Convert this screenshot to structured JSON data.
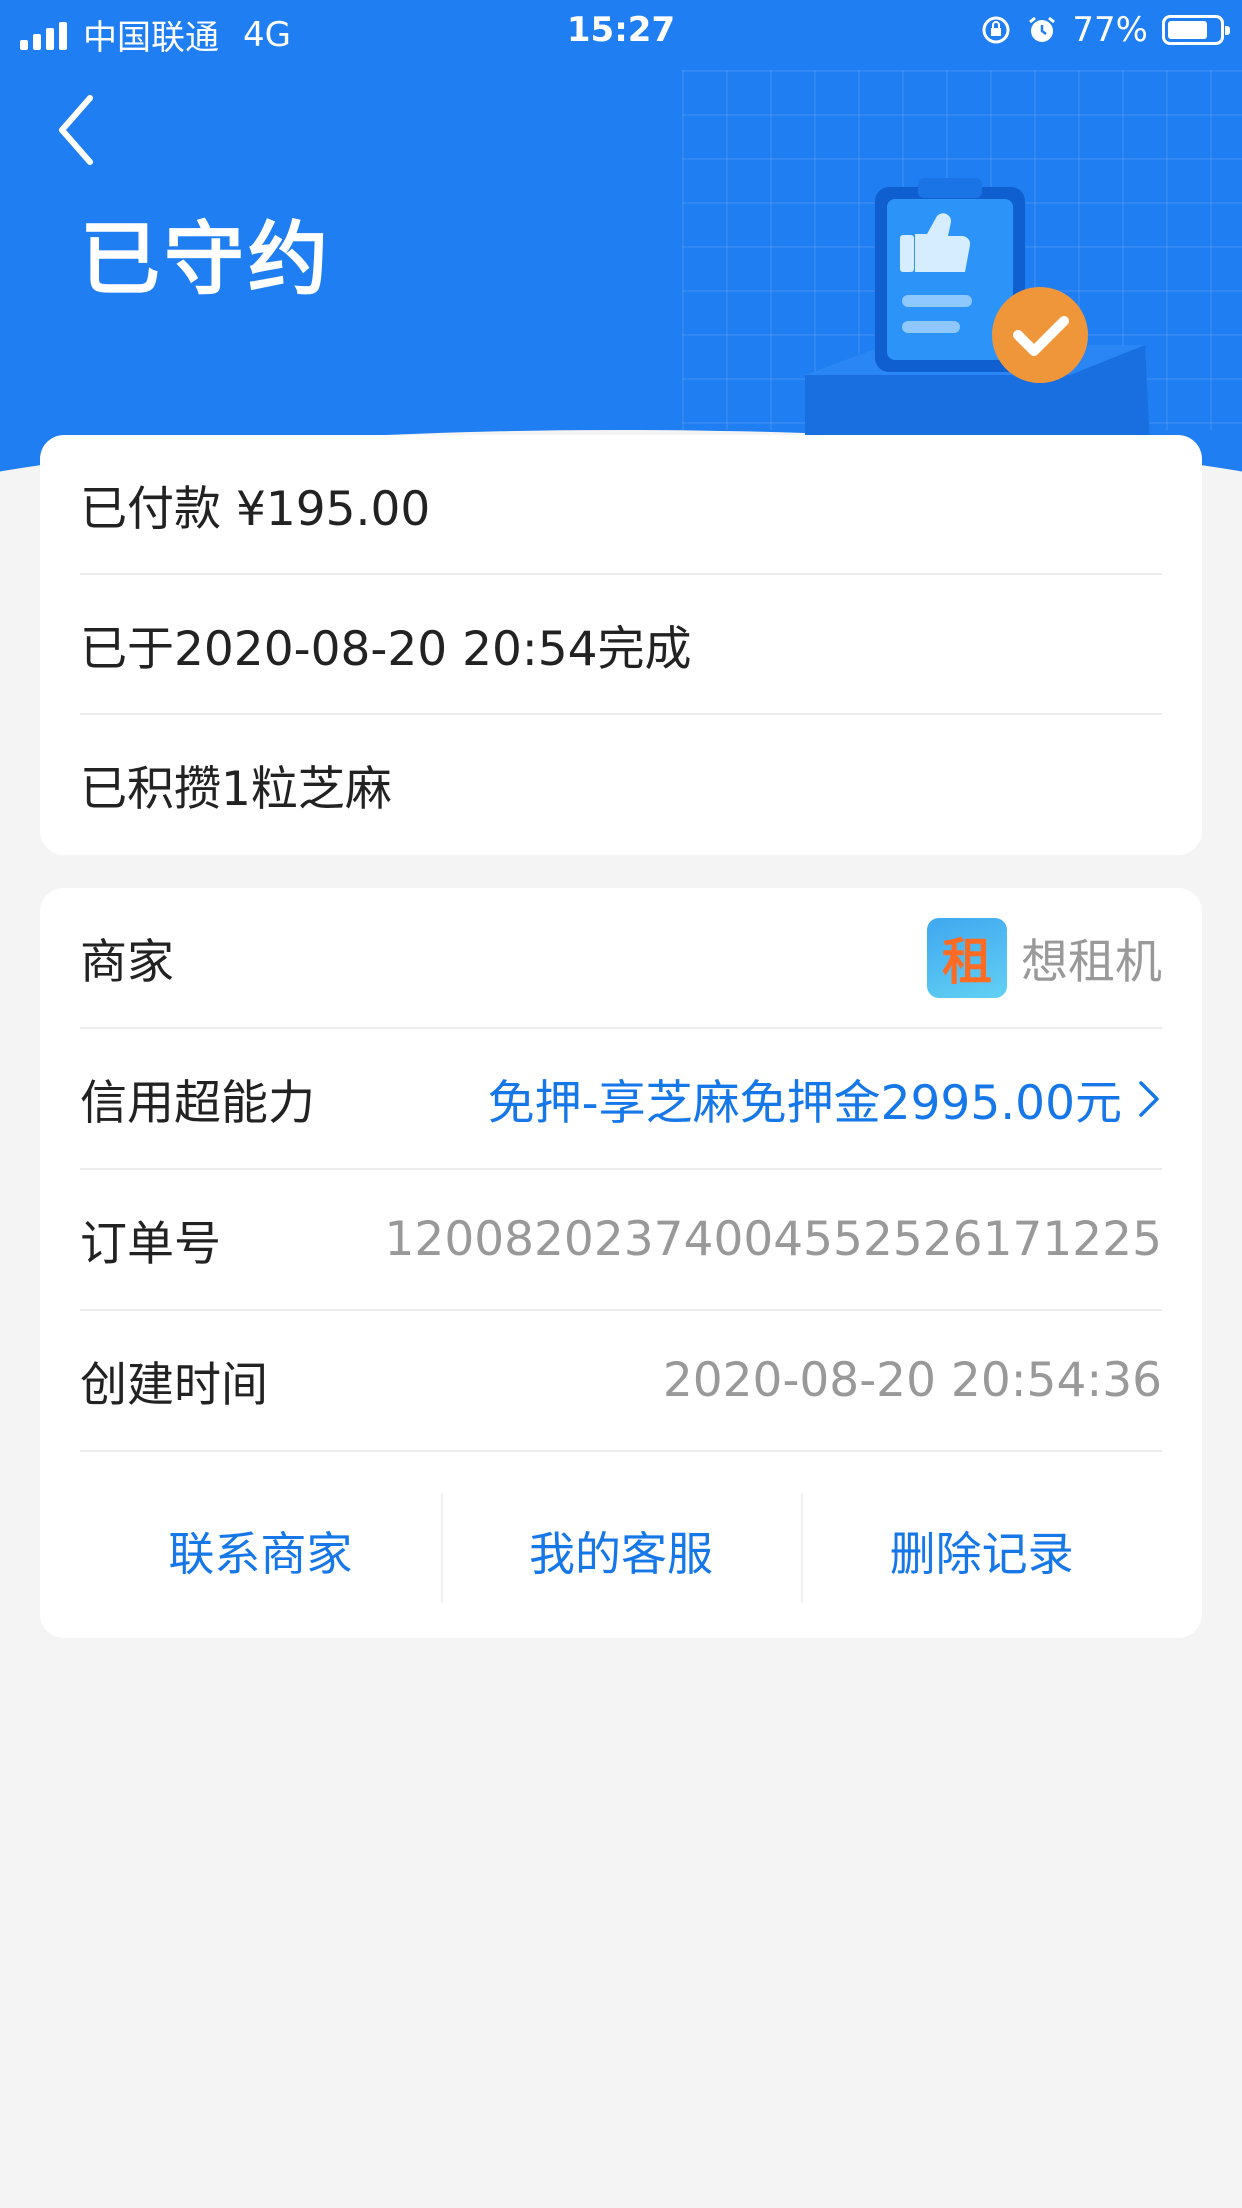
{
  "status_bar": {
    "carrier": "中国联通",
    "network": "4G",
    "time": "15:27",
    "battery": "77%",
    "battery_level": 0.77
  },
  "header": {
    "title": "已守约"
  },
  "summary": {
    "paid": "已付款 ¥195.00",
    "completed": "已于2020-08-20 20:54完成",
    "sesame": "已积攒1粒芝麻"
  },
  "details": {
    "merchant_label": "商家",
    "merchant_logo_char": "租",
    "merchant_name": "想租机",
    "credit_label": "信用超能力",
    "credit_value": "免押-享芝麻免押金2995.00元",
    "order_label": "订单号",
    "order_value": "120082023740045525261712 25",
    "created_label": "创建时间",
    "created_value": "2020-08-20 20:54:36"
  },
  "actions": {
    "contact": "联系商家",
    "service": "我的客服",
    "delete": "删除记录"
  },
  "colors": {
    "header_blue": "#1f7ef1",
    "link_blue": "#1677e8",
    "badge_orange": "#f0963a"
  }
}
